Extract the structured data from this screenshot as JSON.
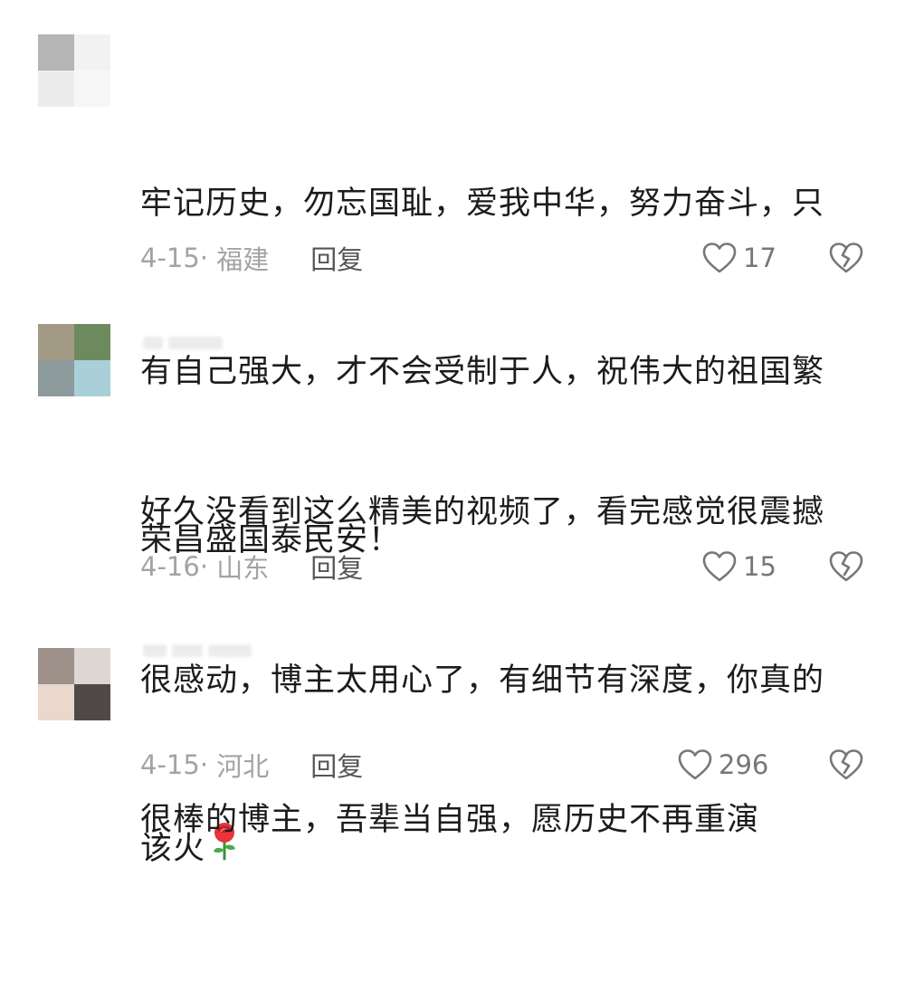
{
  "comments": [
    {
      "text": "牢记历史，勿忘国耻，爱我中华，努力奋斗，只有自己强大，才不会受制于人，祝伟大的祖国繁荣昌盛国泰民安！",
      "lines": [
        "牢记历史，勿忘国耻，爱我中华，努力奋斗，只",
        "有自己强大，才不会受制于人，祝伟大的祖国繁",
        "荣昌盛国泰民安！"
      ],
      "date": "4-15",
      "location": "福建",
      "reply_label": "回复",
      "like_count": "17",
      "avatar_colors": [
        "#b5b5b5",
        "#f2f2f2",
        "#ececec",
        "#f7f7f7"
      ]
    },
    {
      "text": "好久没看到这么精美的视频了，看完感觉很震撼很感动，博主太用心了，有细节有深度，你真的该火",
      "lines": [
        "好久没看到这么精美的视频了，看完感觉很震撼",
        "很感动，博主太用心了，有细节有深度，你真的",
        "该火"
      ],
      "emoji": "rose",
      "date": "4-16",
      "location": "山东",
      "reply_label": "回复",
      "like_count": "15",
      "avatar_colors": [
        "#a39a86",
        "#6d8a5e",
        "#8c9a9c",
        "#a9cfd8"
      ]
    },
    {
      "text": "很棒的博主，吾辈当自强，愿历史不再重演",
      "lines": [
        "很棒的博主，吾辈当自强，愿历史不再重演"
      ],
      "date": "4-15",
      "location": "河北",
      "reply_label": "回复",
      "like_count": "296",
      "avatar_colors": [
        "#9d9189",
        "#ddd7d2",
        "#ead8cc",
        "#4f4a47"
      ]
    }
  ],
  "icons": {
    "like": "heart-outline-icon",
    "dislike": "broken-heart-icon",
    "emoji": "rose-emoji-icon"
  }
}
